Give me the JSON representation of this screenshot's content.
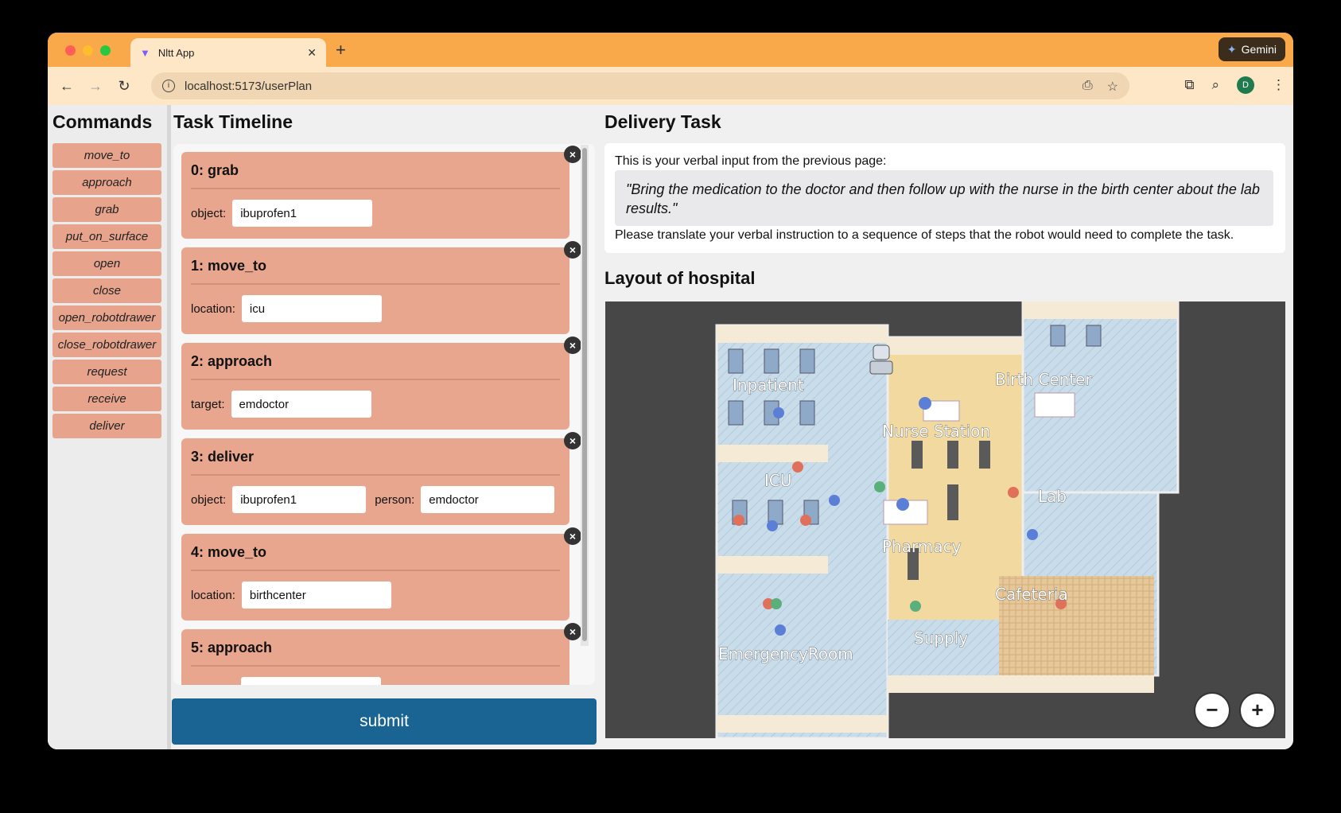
{
  "browser": {
    "tab_title": "Nltt App",
    "tab_close": "✕",
    "new_tab": "+",
    "gemini_label": "Gemini",
    "url": "localhost:5173/userPlan",
    "profile_initial": "D"
  },
  "commands": {
    "title": "Commands",
    "items": [
      "move_to",
      "approach",
      "grab",
      "put_on_surface",
      "open",
      "close",
      "open_robotdrawer",
      "close_robotdrawer",
      "request",
      "receive",
      "deliver"
    ]
  },
  "timeline": {
    "title": "Task Timeline",
    "steps": [
      {
        "header": "0: grab",
        "fields": [
          {
            "label": "object:",
            "value": "ibuprofen1"
          }
        ]
      },
      {
        "header": "1: move_to",
        "fields": [
          {
            "label": "location:",
            "value": "icu"
          }
        ]
      },
      {
        "header": "2: approach",
        "fields": [
          {
            "label": "target:",
            "value": "emdoctor"
          }
        ]
      },
      {
        "header": "3: deliver",
        "fields": [
          {
            "label": "object:",
            "value": "ibuprofen1"
          },
          {
            "label": "person:",
            "value": "emdoctor"
          }
        ]
      },
      {
        "header": "4: move_to",
        "fields": [
          {
            "label": "location:",
            "value": "birthcenter"
          }
        ]
      },
      {
        "header": "5: approach",
        "fields": [
          {
            "label": "",
            "value": ""
          }
        ]
      }
    ],
    "submit_label": "submit"
  },
  "task": {
    "title": "Delivery Task",
    "intro": "This is your verbal input from the previous page:",
    "quote": "\"Bring the medication to the doctor and then follow up with the nurse in the birth center about the lab results.\"",
    "instruction": "Please translate your verbal instruction to a sequence of steps that the robot would need to complete the task."
  },
  "map": {
    "title": "Layout of hospital",
    "rooms": [
      "Inpatient",
      "Nurse Station",
      "Birth Center",
      "ICU",
      "Lab",
      "Pharmacy",
      "Cafeteria",
      "Supply",
      "EmergencyRoom"
    ],
    "zoom_out": "−",
    "zoom_in": "+"
  },
  "colors": {
    "tabbar": "#f9a84a",
    "card": "#e8a68e",
    "submit": "#1a6493",
    "floor_blue": "#c9dcea",
    "floor_tan": "#f2d9a0"
  }
}
